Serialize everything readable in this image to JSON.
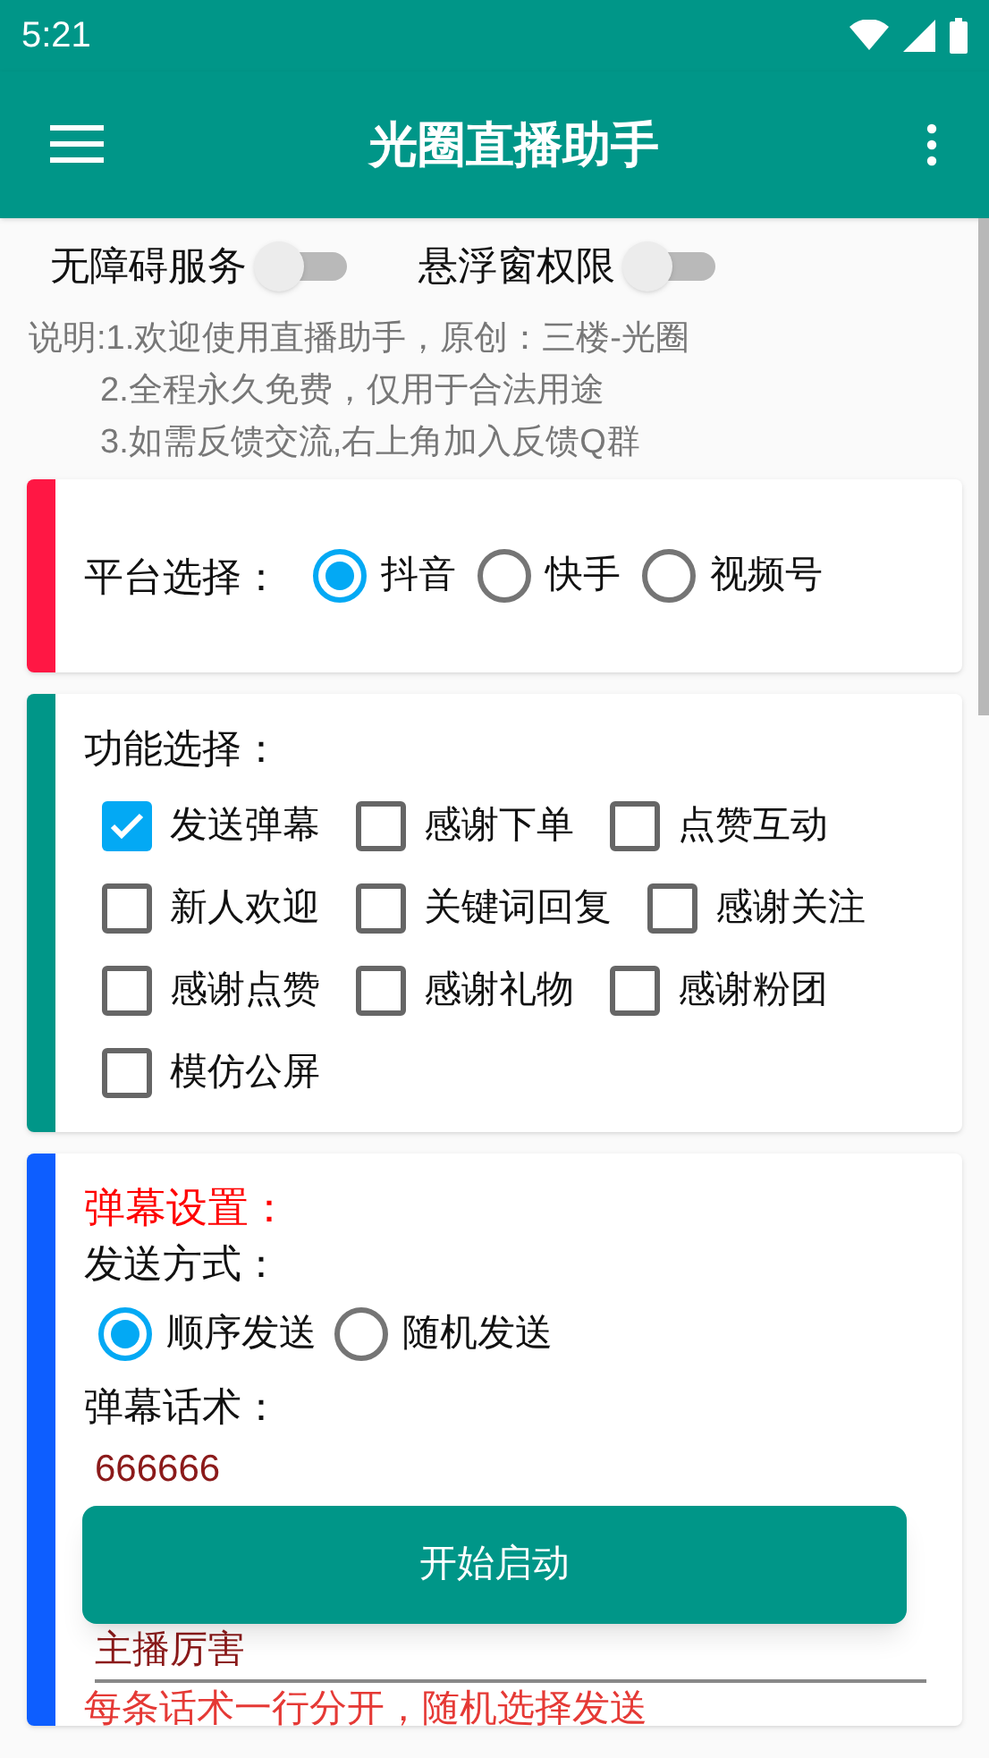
{
  "status_bar": {
    "time": "5:21"
  },
  "app_bar": {
    "title": "光圈直播助手"
  },
  "switches": [
    {
      "label": "无障碍服务",
      "on": false
    },
    {
      "label": "悬浮窗权限",
      "on": false
    }
  ],
  "notes": [
    "说明:1.欢迎使用直播助手，原创：三楼-光圈",
    "2.全程永久免费，仅用于合法用途",
    "3.如需反馈交流,右上角加入反馈Q群"
  ],
  "cards": [
    {
      "kind": "platform",
      "color": "#ff1744",
      "label": "平台选择：",
      "options": [
        {
          "label": "抖音",
          "selected": true
        },
        {
          "label": "快手",
          "selected": false
        },
        {
          "label": "视频号",
          "selected": false
        }
      ]
    },
    {
      "kind": "functions",
      "color": "#009688",
      "label": "功能选择：",
      "rows": [
        [
          {
            "label": "发送弹幕",
            "checked": true
          },
          {
            "label": "感谢下单",
            "checked": false
          },
          {
            "label": "点赞互动",
            "checked": false
          }
        ],
        [
          {
            "label": "新人欢迎",
            "checked": false
          },
          {
            "label": "关键词回复",
            "checked": false
          },
          {
            "label": "感谢关注",
            "checked": false
          }
        ],
        [
          {
            "label": "感谢点赞",
            "checked": false
          },
          {
            "label": "感谢礼物",
            "checked": false
          },
          {
            "label": "感谢粉团",
            "checked": false
          }
        ],
        [
          {
            "label": "模仿公屏",
            "checked": false
          }
        ]
      ]
    },
    {
      "kind": "danmu",
      "color": "#0d5eff",
      "title": "弹幕设置：",
      "mode_label": "发送方式：",
      "modes": [
        {
          "label": "顺序发送",
          "selected": true
        },
        {
          "label": "随机发送",
          "selected": false
        }
      ],
      "script_label": "弹幕话术：",
      "script_lines": [
        "666666",
        "主播厉害"
      ],
      "hint": "每条话术一行分开，随机选择发送"
    }
  ],
  "start_button": "开始启动"
}
